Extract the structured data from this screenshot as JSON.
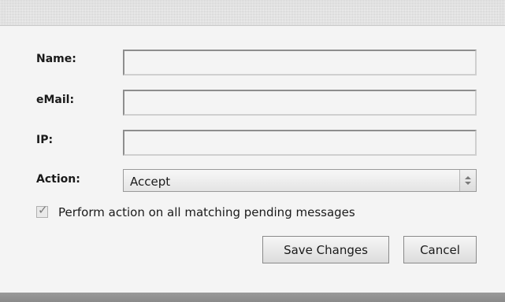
{
  "form": {
    "name_label": "Name:",
    "name_value": "",
    "email_label": "eMail:",
    "email_value": "",
    "ip_label": "IP:",
    "ip_value": "",
    "action_label": "Action:",
    "action_selected": "Accept",
    "checkbox_checked": true,
    "checkbox_label": "Perform action on all matching pending messages"
  },
  "buttons": {
    "save_label": "Save Changes",
    "cancel_label": "Cancel"
  },
  "icons": {
    "checkmark": "check-icon",
    "select_arrows": "up-down-arrows-icon"
  }
}
